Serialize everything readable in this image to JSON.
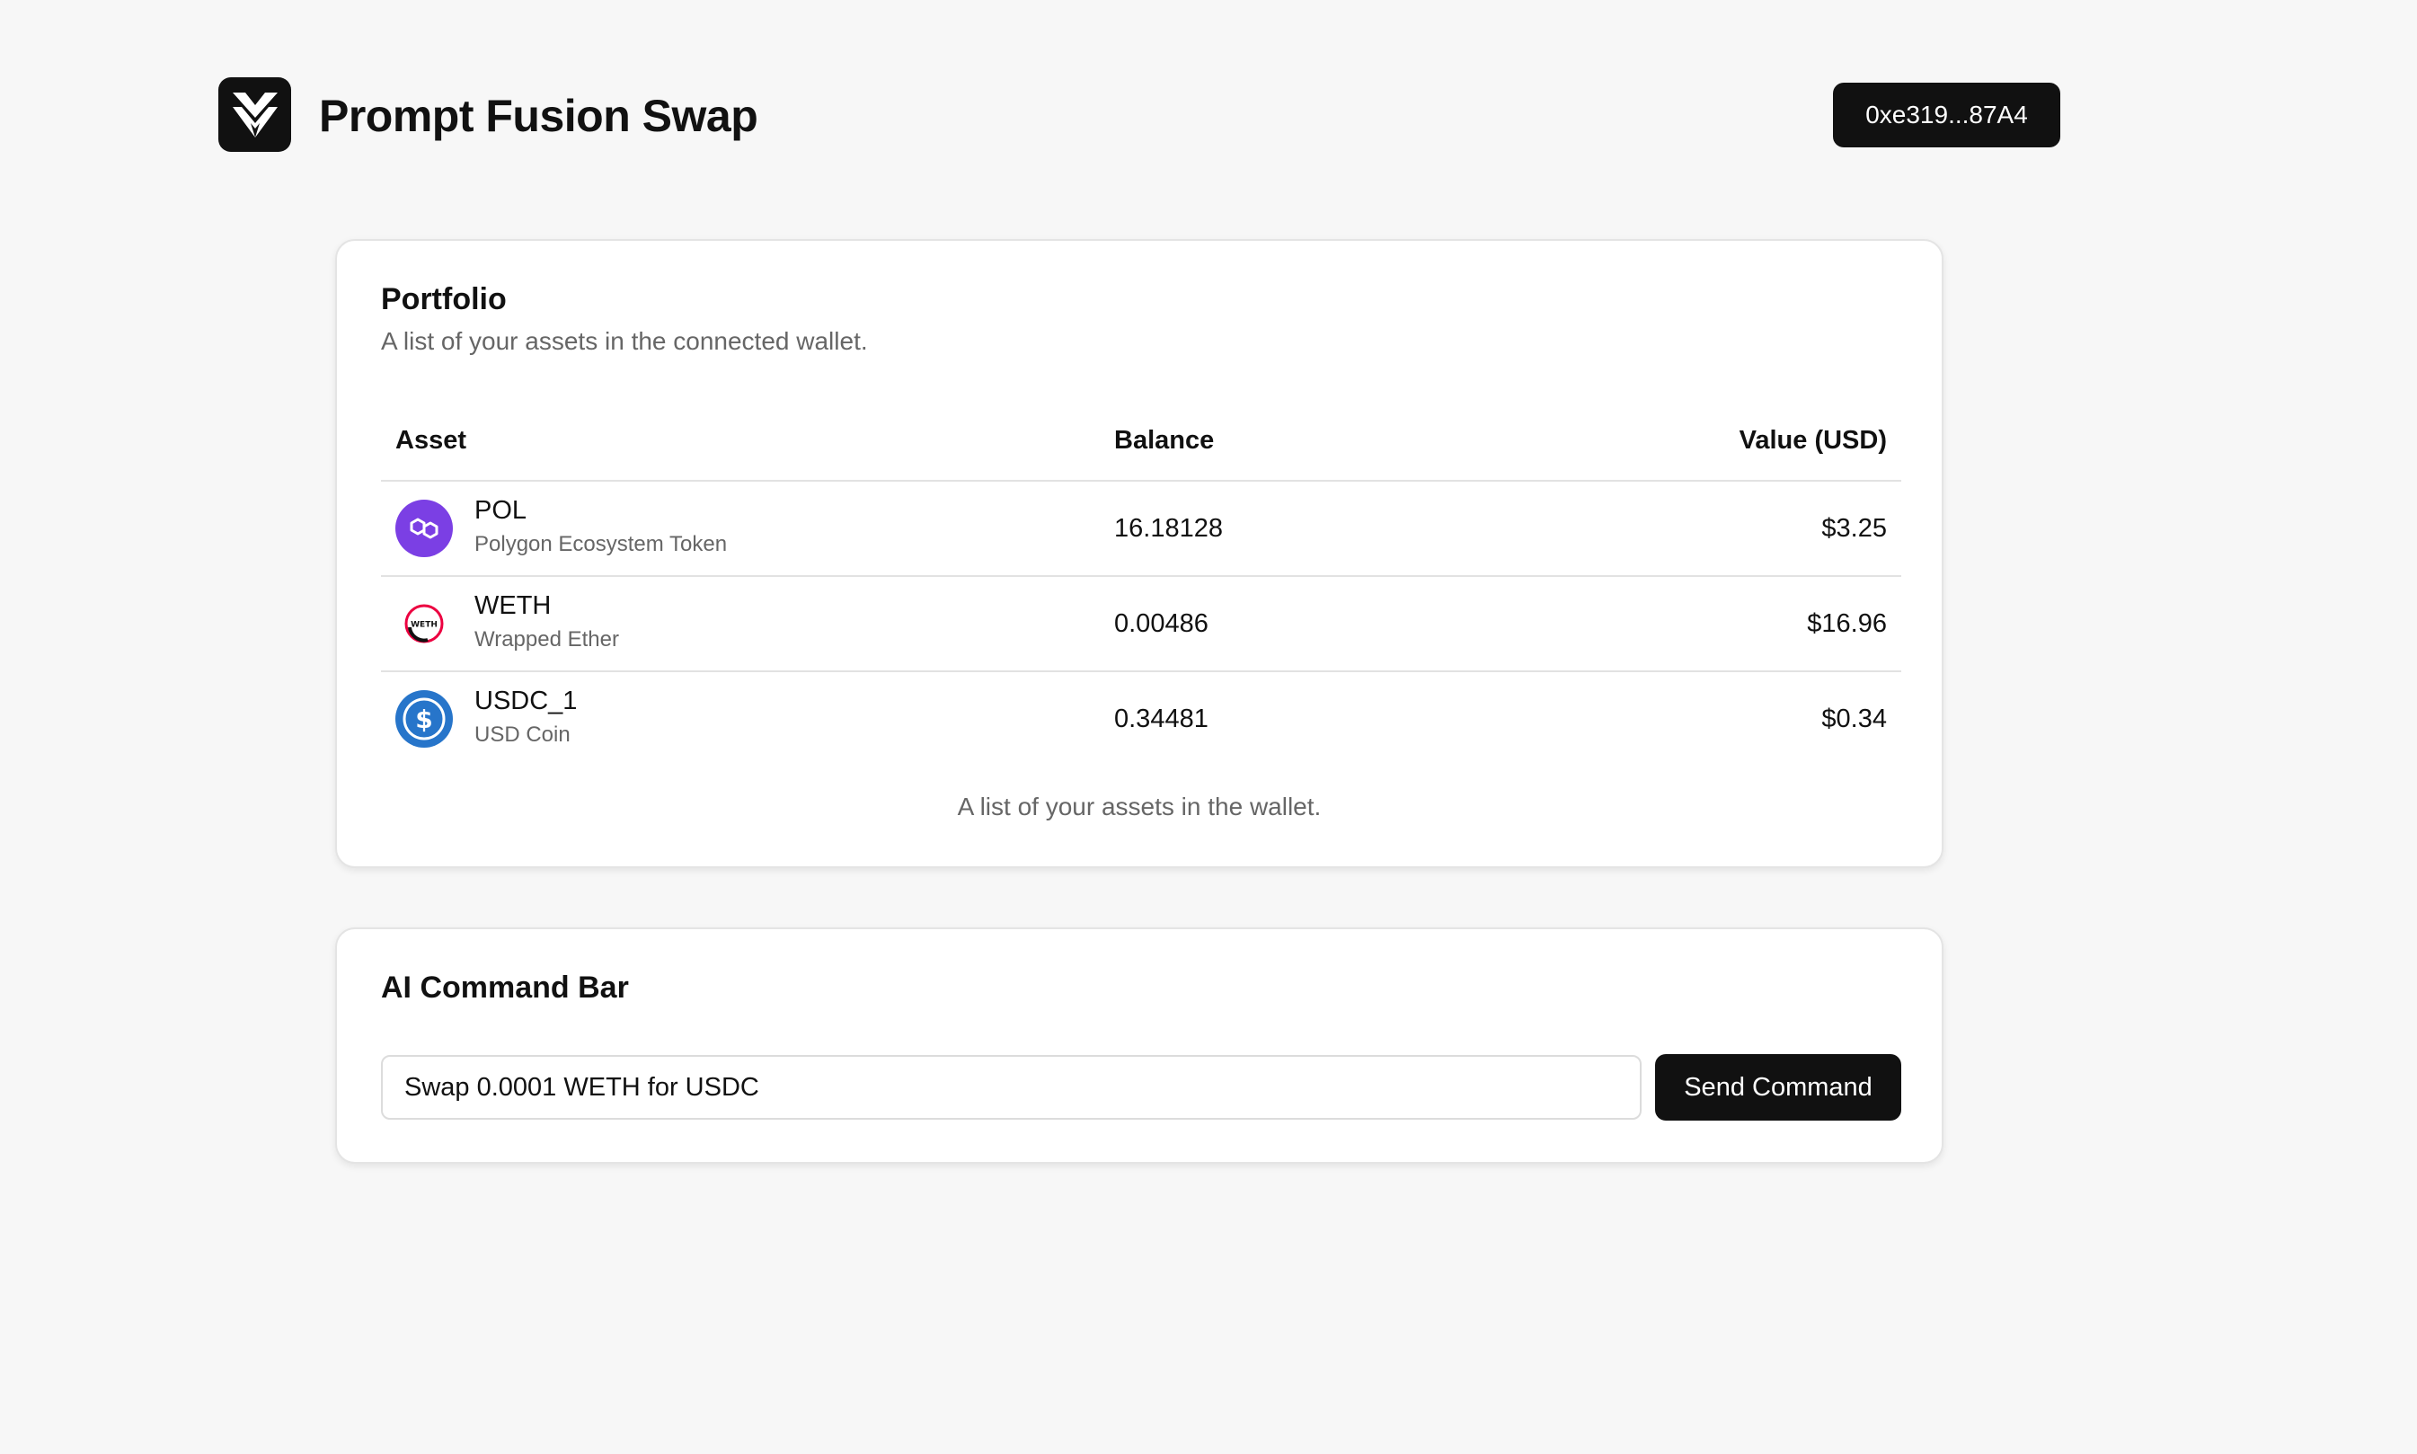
{
  "header": {
    "app_title": "Prompt Fusion Swap",
    "logo_icon": "leaf-shield-logo-icon",
    "wallet_address": "0xe319...87A4"
  },
  "portfolio": {
    "title": "Portfolio",
    "description": "A list of your assets in the connected wallet.",
    "columns": {
      "asset": "Asset",
      "balance": "Balance",
      "value": "Value (USD)"
    },
    "rows": [
      {
        "symbol": "POL",
        "name": "Polygon Ecosystem Token",
        "balance": "16.18128",
        "value": "$3.25",
        "icon": "polygon-icon",
        "icon_color": "#7b3fe4"
      },
      {
        "symbol": "WETH",
        "name": "Wrapped Ether",
        "balance": "0.00486",
        "value": "$16.96",
        "icon": "weth-icon",
        "icon_color": "#ec0040",
        "icon_text": "WETH"
      },
      {
        "symbol": "USDC_1",
        "name": "USD Coin",
        "balance": "0.34481",
        "value": "$0.34",
        "icon": "usdc-icon",
        "icon_color": "#2775ca",
        "icon_text": "$"
      }
    ],
    "caption": "A list of your assets in the wallet."
  },
  "command_bar": {
    "title": "AI Command Bar",
    "input_value": "Swap 0.0001 WETH for USDC",
    "send_label": "Send Command"
  },
  "colors": {
    "background": "#f7f7f7",
    "primary": "#111111",
    "muted_text": "#666666",
    "border": "#e4e4e4"
  }
}
